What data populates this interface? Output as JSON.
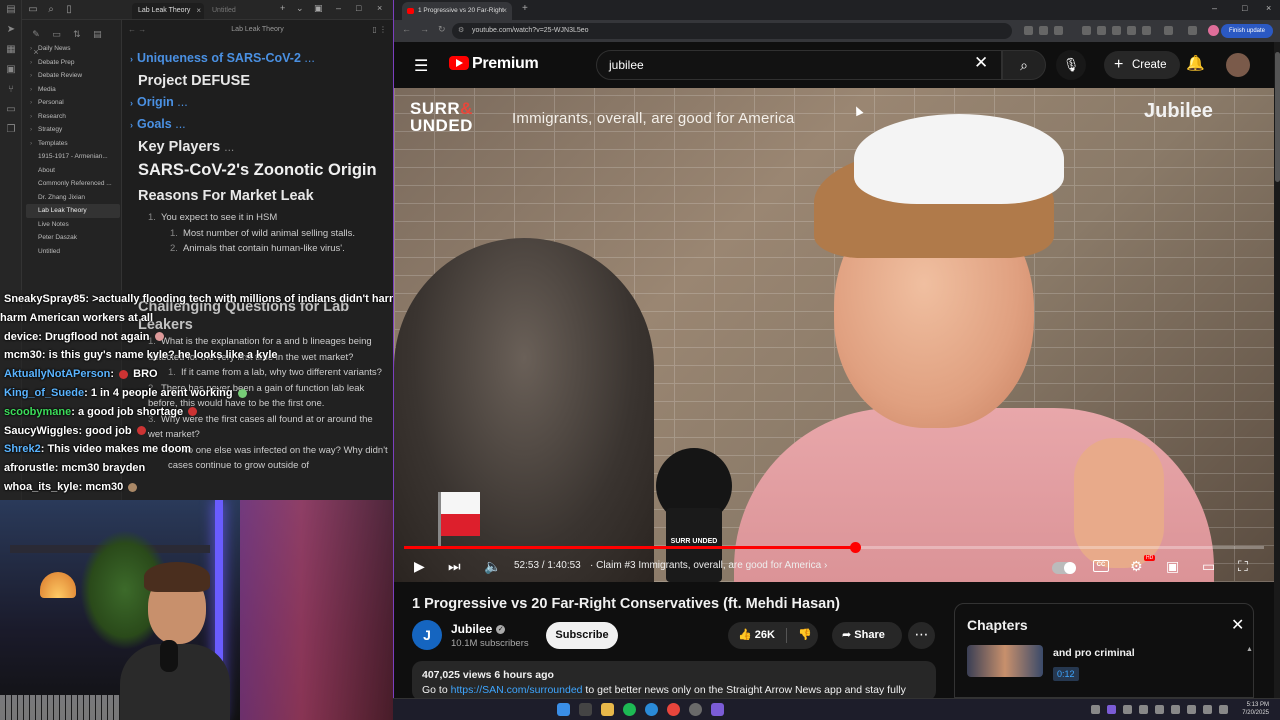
{
  "notes_app": {
    "tabs": [
      {
        "label": "Lab Leak Theory",
        "active": true
      },
      {
        "label": "Untitled",
        "active": false
      }
    ],
    "header_title": "Lab Leak Theory",
    "file_tree": [
      {
        "label": "Daily News",
        "folder": true
      },
      {
        "label": "Debate Prep",
        "folder": true
      },
      {
        "label": "Debate Review",
        "folder": true
      },
      {
        "label": "Media",
        "folder": true
      },
      {
        "label": "Personal",
        "folder": true
      },
      {
        "label": "Research",
        "folder": true
      },
      {
        "label": "Strategy",
        "folder": true
      },
      {
        "label": "Templates",
        "folder": true
      },
      {
        "label": "1915-1917 - Armenian...",
        "folder": false
      },
      {
        "label": "About",
        "folder": false
      },
      {
        "label": "Commonly Referenced ...",
        "folder": false
      },
      {
        "label": "Dr. Zhang Jixian",
        "folder": false
      },
      {
        "label": "Lab Leak Theory",
        "folder": false,
        "active": true
      },
      {
        "label": "Live Notes",
        "folder": false
      },
      {
        "label": "Peter Daszak",
        "folder": false
      },
      {
        "label": "Untitled",
        "folder": false
      }
    ],
    "doc": {
      "h_uniqueness": "Uniqueness of SARS-CoV-2",
      "h_defuse": "Project DEFUSE",
      "h_origin": "Origin",
      "h_goals": "Goals",
      "h_players": "Key Players",
      "h_zoonotic": "SARS-CoV-2's Zoonotic Origin",
      "h_market": "Reasons For Market Leak",
      "item_1": "You expect to see it in HSM",
      "sub_1": "Most number of wild animal selling stalls.",
      "sub_2": "Animals that contain human-like virus'.",
      "h_challenging": "Challenging Questions for Lab Leakers",
      "q1": "What is the explanation for a and b lineages being detected for the very first time in the wet market?",
      "q1a": "If it came from a lab, why two different variants?",
      "q2": "There has never been a gain of function lab leak before, this would have to be the first one.",
      "q3": "Why were the first cases all found at or around the wet market?",
      "q3a": "No one else was infected on the way? Why didn't cases continue to grow outside of"
    }
  },
  "chat": [
    {
      "name": "SneakySpray85",
      "color": "#ffffff",
      "text": ">actually flooding tech with millions of indians didn't harm American workers at all"
    },
    {
      "name": "device",
      "color": "#ffffff",
      "text": "Drugflood not again"
    },
    {
      "name": "mcm30",
      "color": "#ffffff",
      "text": "is this guy's name kyle? he looks like a kyle"
    },
    {
      "name": "AktuallyNotAPerson",
      "color": "#5ab4ff",
      "text": "BRO"
    },
    {
      "name": "King_of_Suede",
      "color": "#5ab4ff",
      "text": "1 in 4 people arent working"
    },
    {
      "name": "scoobymane",
      "color": "#3cdc5a",
      "text": "a good job shortage"
    },
    {
      "name": "SaucyWiggles",
      "color": "#ffffff",
      "text": "good job"
    },
    {
      "name": "Shrek2",
      "color": "#5ab4ff",
      "text": "This video makes me doom"
    },
    {
      "name": "afrorustle",
      "color": "#ffffff",
      "text": "mcm30 brayden"
    },
    {
      "name": "whoa_its_kyle",
      "color": "#ffffff",
      "text": "mcm30"
    }
  ],
  "browser": {
    "tab_title": "1 Progressive vs 20 Far-Right",
    "url": "youtube.com/watch?v=25-WJN3L5eo",
    "finish_update": "Finish update"
  },
  "youtube": {
    "brand": "Premium",
    "search_value": "jubilee",
    "create_label": "Create",
    "video": {
      "logo_line1": "SURR",
      "logo_line2": "UNDED",
      "claim_overlay": "Immigrants, overall, are good for America",
      "watermark": "Jubilee",
      "mic_label": "SURR UNDED",
      "time_current": "52:53",
      "time_total": "1:40:53",
      "chapter": "Claim #3 Immigrants, overall, are good for America",
      "progress_fraction": 0.524,
      "buffered_fraction": 0.53
    },
    "title": "1 Progressive vs 20 Far-Right Conservatives (ft. Mehdi Hasan)",
    "channel": {
      "avatar_letter": "J",
      "name": "Jubilee",
      "subscribers": "10.1M subscribers",
      "subscribe_label": "Subscribe"
    },
    "likes": "26K",
    "share_label": "Share",
    "description": {
      "meta": "407,025 views  6 hours ago",
      "prefix": "Go to ",
      "link": "https://SAN.com/surrounded",
      "suffix": " to get better news only on the Straight Arrow News app and stay fully"
    },
    "chapters_panel": {
      "title": "Chapters",
      "item_text": "and pro criminal",
      "item_time": "0:12"
    }
  },
  "taskbar": {
    "time": "5:13 PM",
    "date": "7/20/2025"
  },
  "colors": {
    "yt_red": "#ff0000",
    "link_blue": "#3ea6ff",
    "obsidian_heading_blue": "#4a90e2",
    "shirt_pink": "#e8a7aa"
  }
}
